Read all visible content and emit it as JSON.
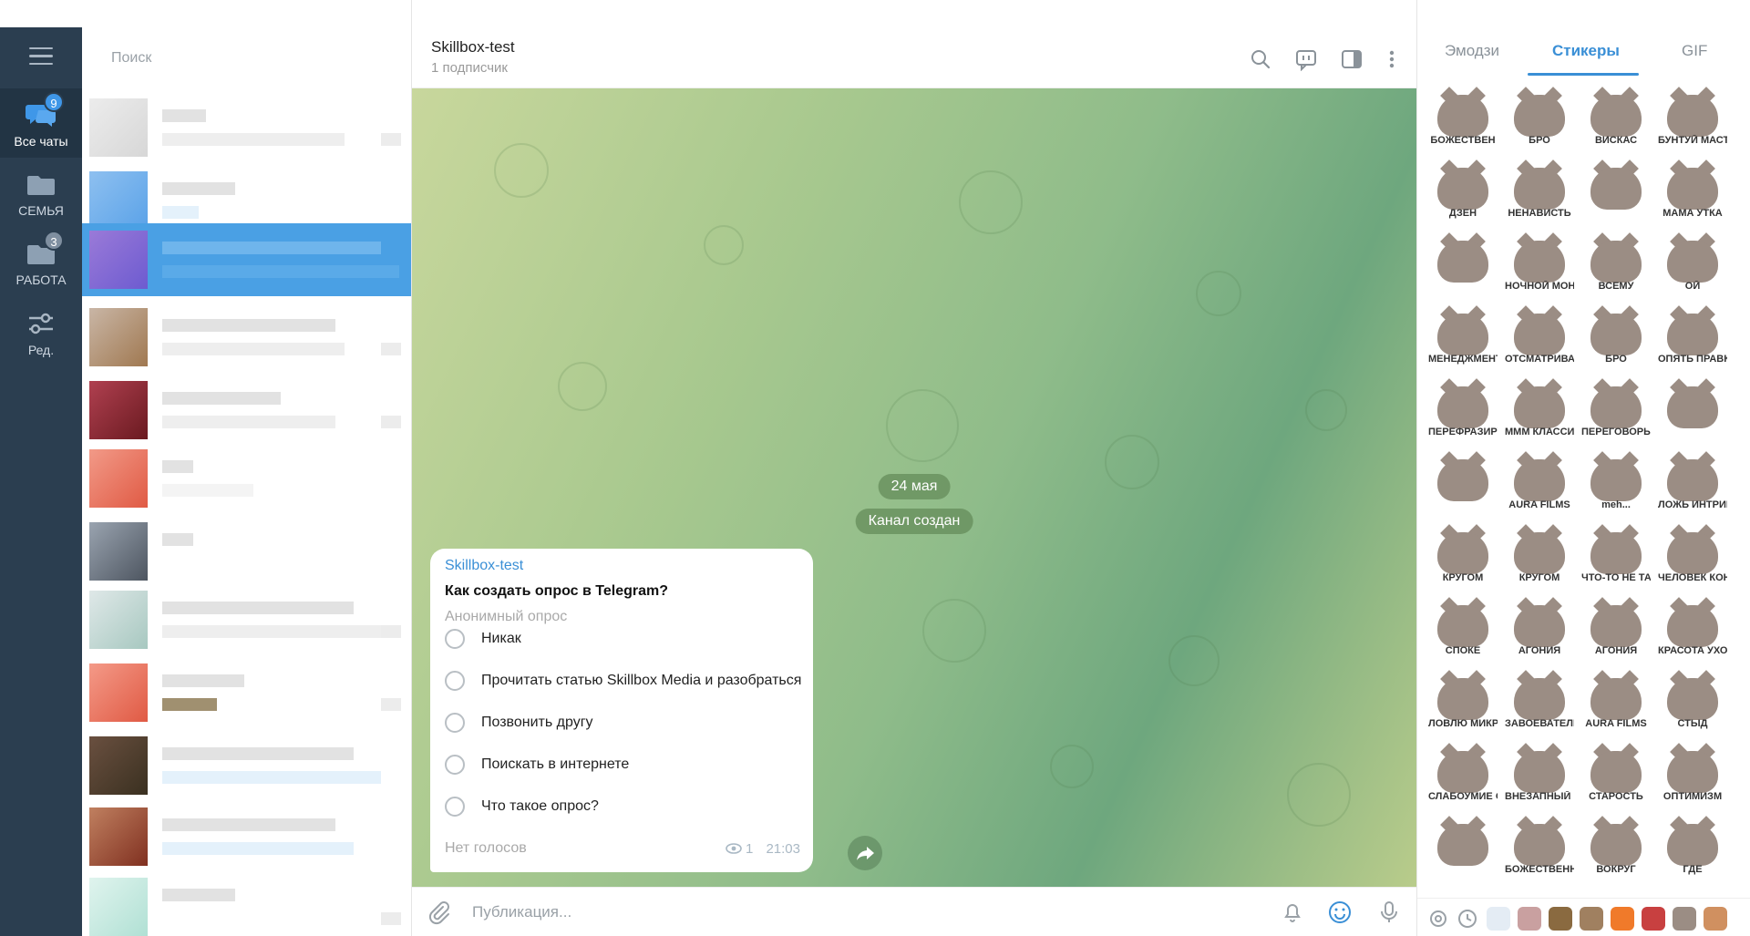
{
  "window": {
    "controls": [
      "—",
      "❐",
      "✕"
    ]
  },
  "rail": {
    "folders": [
      {
        "label": "Все чаты",
        "badge": "9",
        "icon": "chat-bubbles-icon"
      },
      {
        "label": "СЕМЬЯ",
        "badge": "",
        "icon": "folder-icon"
      },
      {
        "label": "РАБОТА",
        "badge": "3",
        "icon": "folder-icon"
      },
      {
        "label": "Ред.",
        "badge": "",
        "icon": "sliders-icon"
      }
    ]
  },
  "chatlist": {
    "search_placeholder": "Поиск"
  },
  "header": {
    "title": "Skillbox-test",
    "subtitle": "1 подписчик"
  },
  "chat": {
    "date_pill": "24 мая",
    "service_pill": "Канал создан",
    "poll": {
      "author": "Skillbox-test",
      "question": "Как создать опрос в Telegram?",
      "type": "Анонимный опрос",
      "options": [
        "Никак",
        "Прочитать статью Skillbox Media и разобраться",
        "Позвонить другу",
        "Поискать в интернете",
        "Что такое опрос?"
      ],
      "footer": "Нет голосов",
      "views": "1",
      "time": "21:03"
    }
  },
  "composer": {
    "placeholder": "Публикация..."
  },
  "stickers": {
    "tabs": [
      "Эмодзи",
      "Стикеры",
      "GIF"
    ],
    "active_tab": "Стикеры",
    "captions": [
      "БОЖЕСТВЕН",
      "БРО",
      "ВИСКАС",
      "БУНТУЙ МАСТЕР НЕ СМОТРИ",
      "ДЗЕН",
      "НЕНАВИСТЬ",
      "",
      "МАМА УТКА",
      "",
      "НОЧНОЙ МОНТАЖ",
      "ВСЕМУ",
      "ОЙ",
      "МЕНЕДЖМЕНТ",
      "ОТСМАТРИВАЙ МАСТЕР",
      "БРО",
      "ОПЯТЬ ПРАВКИ",
      "ПЕРЕФРАЗИРУЙ",
      "МММ КЛАССИКА",
      "ПЕРЕГОВОРЫ С ТЕРРОРИСТАМИ",
      "",
      "",
      "AURA FILMS",
      "meh...",
      "ЛОЖЬ ИНТРИГА ПОДЛОГ",
      "КРУГОМ",
      "КРУГОМ",
      "ЧТО-ТО НЕ ТАК",
      "ЧЕЛОВЕК КОНСЕРВ",
      "СПОКЕ",
      "АГОНИЯ",
      "АГОНИЯ",
      "КРАСОТА УХОЖЕННОСТЬ",
      "ЛОВЛЮ МИКРУХИ",
      "ЗАВОЕВАТЕЛЬ",
      "AURA FILMS",
      "СТЫД",
      "СЛАБОУМИЕ ОТВАГА",
      "ВНЕЗАПНЫЙ ПОВОРОТ",
      "СТАРОСТЬ",
      "ОПТИМИЗМ",
      "",
      "БОЖЕСТВЕННО",
      "ВОКРУГ",
      "ГДЕ"
    ]
  }
}
